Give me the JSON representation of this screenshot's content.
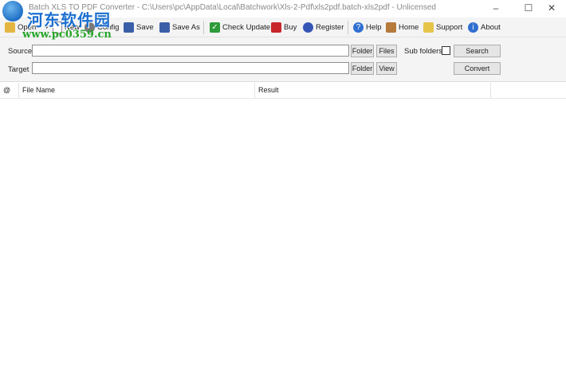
{
  "window": {
    "title": "Batch XLS TO PDF Converter - C:\\Users\\pc\\AppData\\Local\\Batchwork\\Xls-2-Pdf\\xls2pdf.batch-xls2pdf - Unlicensed",
    "minimize_glyph": "–",
    "maximize_glyph": "☐",
    "close_glyph": "✕"
  },
  "watermark": {
    "text_cn": "河东软件园",
    "url": "www.pc0359.cn"
  },
  "toolbar": {
    "open": "Open",
    "new": "New",
    "config": "Config",
    "save": "Save",
    "save_as": "Save As",
    "check_update": "Check Update",
    "buy": "Buy",
    "register": "Register",
    "help": "Help",
    "home": "Home",
    "support": "Support",
    "about": "About"
  },
  "form": {
    "source_label": "Source",
    "target_label": "Target",
    "source_value": "",
    "target_value": "",
    "folder_label": "Folder",
    "files_label": "Files",
    "view_label": "View",
    "sub_folders_label": "Sub folders",
    "sub_folders_checked": false,
    "search_label": "Search",
    "convert_label": "Convert"
  },
  "grid": {
    "columns": [
      "@",
      "File Name",
      "Result"
    ]
  },
  "colors": {
    "accent": "#1f6fc4",
    "watermark_green": "#27a52b"
  }
}
